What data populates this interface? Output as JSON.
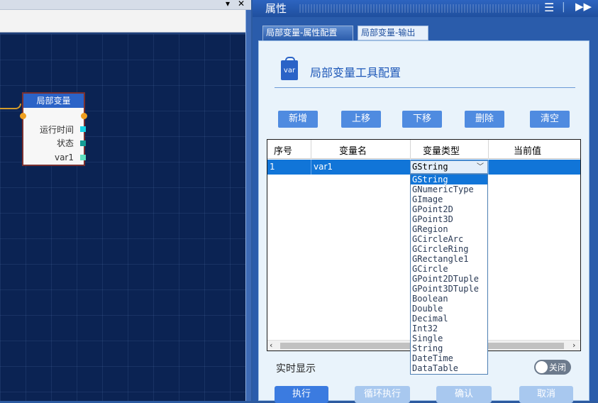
{
  "canvas": {
    "node": {
      "title": "局部变量",
      "rows": [
        "运行时间",
        "状态",
        "var1"
      ]
    }
  },
  "props": {
    "header_title": "属性",
    "tabs": [
      "局部变量-属性配置",
      "局部变量-输出"
    ],
    "config_icon_text": "var",
    "config_title": "局部变量工具配置",
    "buttons": [
      "新增",
      "上移",
      "下移",
      "删除",
      "清空"
    ],
    "table": {
      "columns": [
        "序号",
        "变量名",
        "变量类型",
        "当前值"
      ],
      "rows": [
        {
          "index": "1",
          "name": "var1",
          "type": "GString",
          "value": ""
        }
      ]
    },
    "type_options": [
      "GString",
      "GNumericType",
      "GImage",
      "GPoint2D",
      "GPoint3D",
      "GRegion",
      "GCircleArc",
      "GCircleRing",
      "GRectangle1",
      "GCircle",
      "GPoint2DTuple",
      "GPoint3DTuple",
      "Boolean",
      "Double",
      "Decimal",
      "Int32",
      "Single",
      "String",
      "DateTime",
      "DataTable"
    ],
    "realtime_label": "实时显示",
    "realtime_toggle": "关闭",
    "bottom_buttons": [
      "执行",
      "循环执行",
      "确认",
      "取消"
    ]
  },
  "colors": {
    "canvas_bg": "#0b2353",
    "accent": "#1175d8",
    "button": "#4f8be0",
    "node_header": "#2b63c7"
  }
}
